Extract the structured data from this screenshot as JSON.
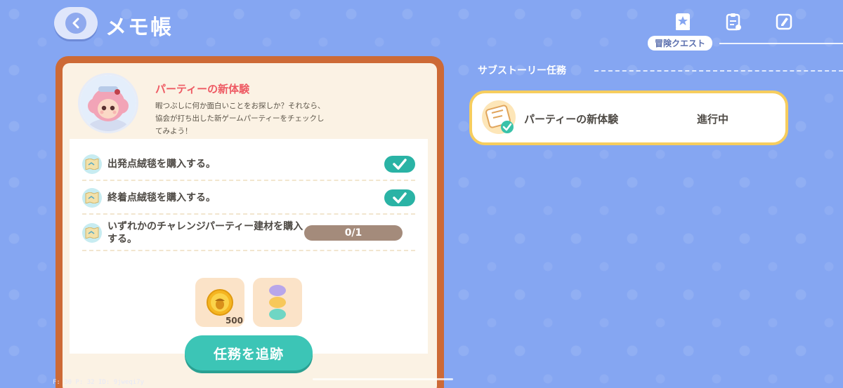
{
  "header": {
    "title": "メモ帳",
    "active_tab_label": "冒険クエスト"
  },
  "quest": {
    "title": "パーティーの新体験",
    "description": "暇つぶしに何か面白いことをお探しか？それなら、協会が打ち出した新ゲームパーティーをチェックしてみよう！",
    "tasks": [
      {
        "text": "出発点絨毯を購入する。",
        "status": "completed"
      },
      {
        "text": "終着点絨毯を購入する。",
        "status": "completed"
      },
      {
        "text": "いずれかのチャレンジパーティー建材を購入する。",
        "status": "in_progress",
        "progress": "0/1"
      }
    ],
    "rewards": [
      {
        "icon": "acorn-coin-icon",
        "count": "500"
      },
      {
        "icon": "macaron-stack-icon",
        "count": ""
      }
    ],
    "track_button": "任務を追跡"
  },
  "side": {
    "section_title": "サブストーリー任務",
    "cards": [
      {
        "title": "パーティーの新体験",
        "status": "進行中"
      }
    ]
  },
  "debug": "F: 30    P: 32    ID: 9jweqi7y",
  "colors": {
    "background": "#85a6f2",
    "panel_border": "#cd6a36",
    "accent_teal": "#3cc5b6",
    "title_red": "#ee5a63",
    "card_border": "#f6cd5e"
  }
}
